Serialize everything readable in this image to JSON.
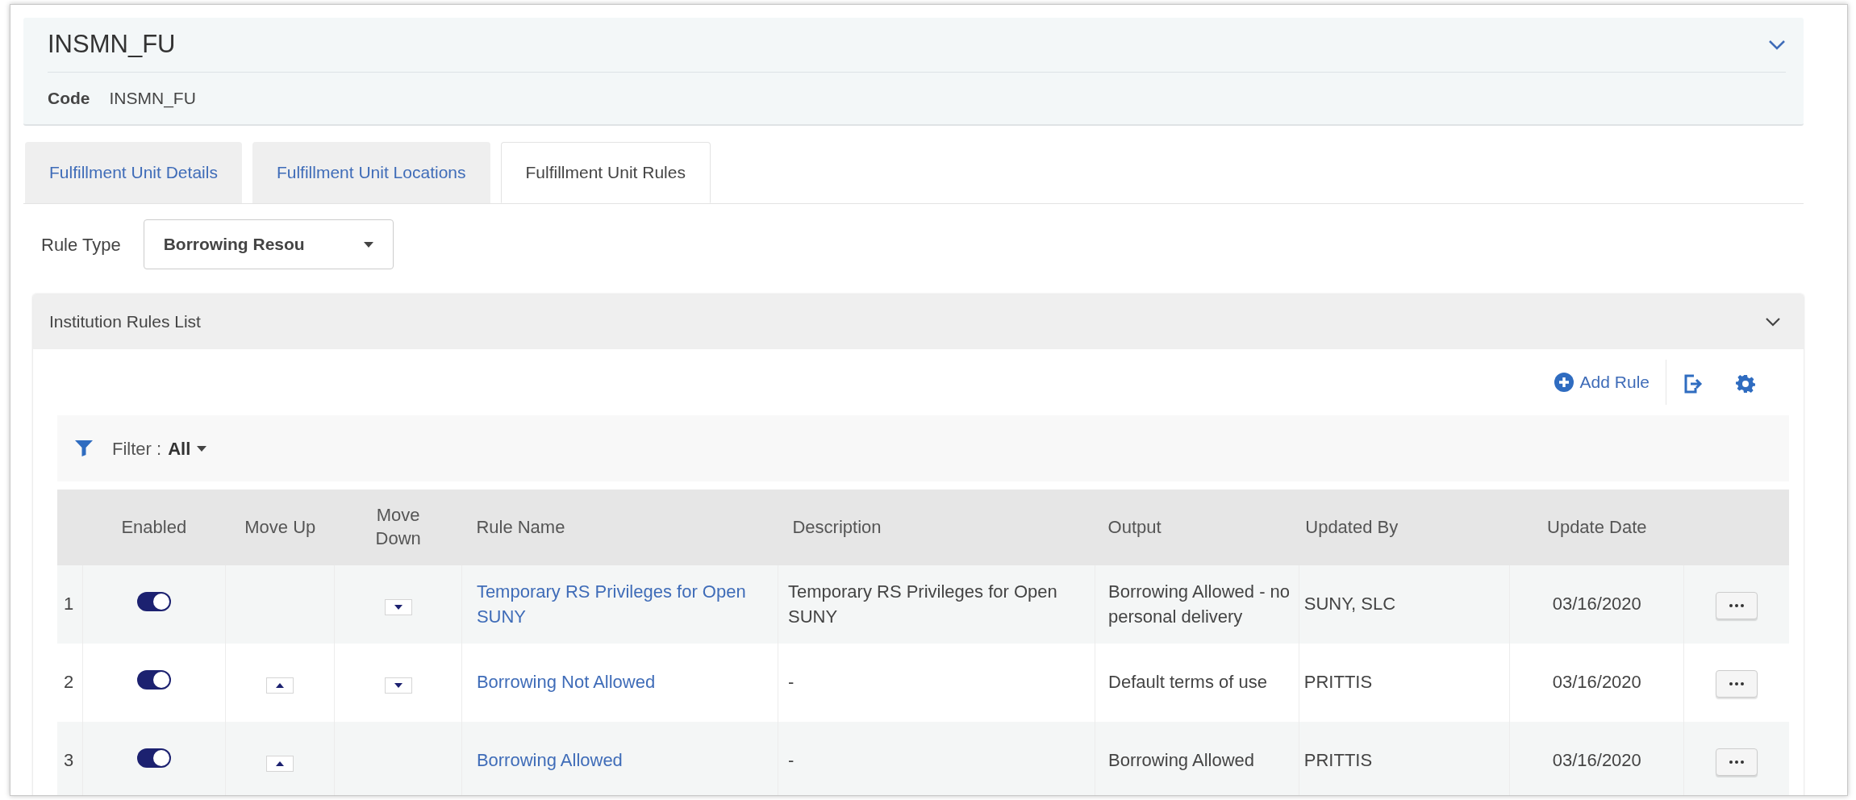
{
  "header": {
    "title": "INSMN_FU",
    "code_label": "Code",
    "code_value": "INSMN_FU"
  },
  "tabs": [
    {
      "label": "Fulfillment Unit Details",
      "selected": false
    },
    {
      "label": "Fulfillment Unit Locations",
      "selected": false
    },
    {
      "label": "Fulfillment Unit Rules",
      "selected": true
    }
  ],
  "rule_type": {
    "label": "Rule Type",
    "value": "Borrowing Resou"
  },
  "rules_panel": {
    "title": "Institution Rules List",
    "add_label": "Add Rule",
    "filter": {
      "label": "Filter :",
      "value": "All"
    },
    "table": {
      "columns": [
        "Enabled",
        "Move Up",
        "Move Down",
        "Rule Name",
        "Description",
        "Output",
        "Updated By",
        "Update Date"
      ],
      "rows": [
        {
          "number": "1",
          "enabled": true,
          "can_move_up": false,
          "can_move_down": true,
          "rule_name": "Temporary RS Privileges for Open SUNY",
          "description": "Temporary RS Privileges for Open SUNY",
          "output": "Borrowing Allowed - no personal delivery",
          "updated_by": "SUNY, SLC",
          "update_date": "03/16/2020"
        },
        {
          "number": "2",
          "enabled": true,
          "can_move_up": true,
          "can_move_down": true,
          "rule_name": "Borrowing Not Allowed",
          "description": "-",
          "output": "Default terms of use",
          "updated_by": "PRITTIS",
          "update_date": "03/16/2020"
        },
        {
          "number": "3",
          "enabled": true,
          "can_move_up": true,
          "can_move_down": false,
          "rule_name": "Borrowing Allowed",
          "description": "-",
          "output": "Borrowing Allowed",
          "updated_by": "PRITTIS",
          "update_date": "03/16/2020"
        }
      ]
    }
  }
}
